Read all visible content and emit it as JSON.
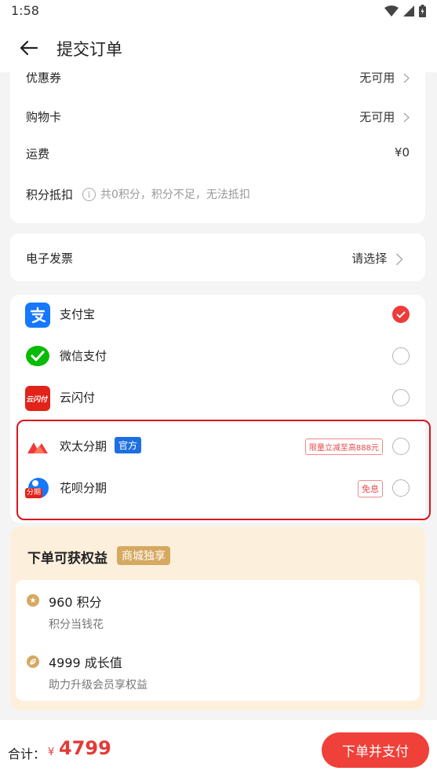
{
  "status_bar": {
    "time": "1:58"
  },
  "header": {
    "title": "提交订单"
  },
  "order_details": {
    "coupon": {
      "label": "优惠券",
      "value": "无可用"
    },
    "shopping_card": {
      "label": "购物卡",
      "value": "无可用"
    },
    "shipping": {
      "label": "运费",
      "value": "¥0"
    },
    "points": {
      "label": "积分抵扣",
      "note": "共0积分，积分不足，无法抵扣"
    }
  },
  "invoice": {
    "label": "电子发票",
    "value": "请选择"
  },
  "payment_methods": [
    {
      "name": "支付宝",
      "icon": "alipay-icon",
      "checked": true
    },
    {
      "name": "微信支付",
      "icon": "wechat-pay-icon",
      "checked": false
    },
    {
      "name": "云闪付",
      "icon": "unionpay-icon",
      "icon_text": "云闪付",
      "checked": false
    },
    {
      "name": "欢太分期",
      "icon": "huantai-icon",
      "tag": "官方",
      "promo": "限量立减至高888元",
      "checked": false
    },
    {
      "name": "花呗分期",
      "icon": "huabei-icon",
      "icon_text": "分期",
      "promo": "免息",
      "checked": false
    }
  ],
  "benefits": {
    "title": "下单可获权益",
    "tag": "商城独享",
    "items": [
      {
        "icon": "star-coin-icon",
        "main": "960 积分",
        "sub": "积分当钱花"
      },
      {
        "icon": "growth-leaf-icon",
        "main": "4999 成长值",
        "sub": "助力升级会员享权益"
      }
    ]
  },
  "footer": {
    "total_label": "合计：",
    "currency": "¥",
    "total_amount": "4799",
    "submit_label": "下单并支付"
  },
  "colors": {
    "accent_red": "#ef4039",
    "alipay_blue": "#1677ff",
    "wechat_green": "#09bb07",
    "benefit_gold": "#d6a961",
    "highlight_border": "#d9141e"
  }
}
